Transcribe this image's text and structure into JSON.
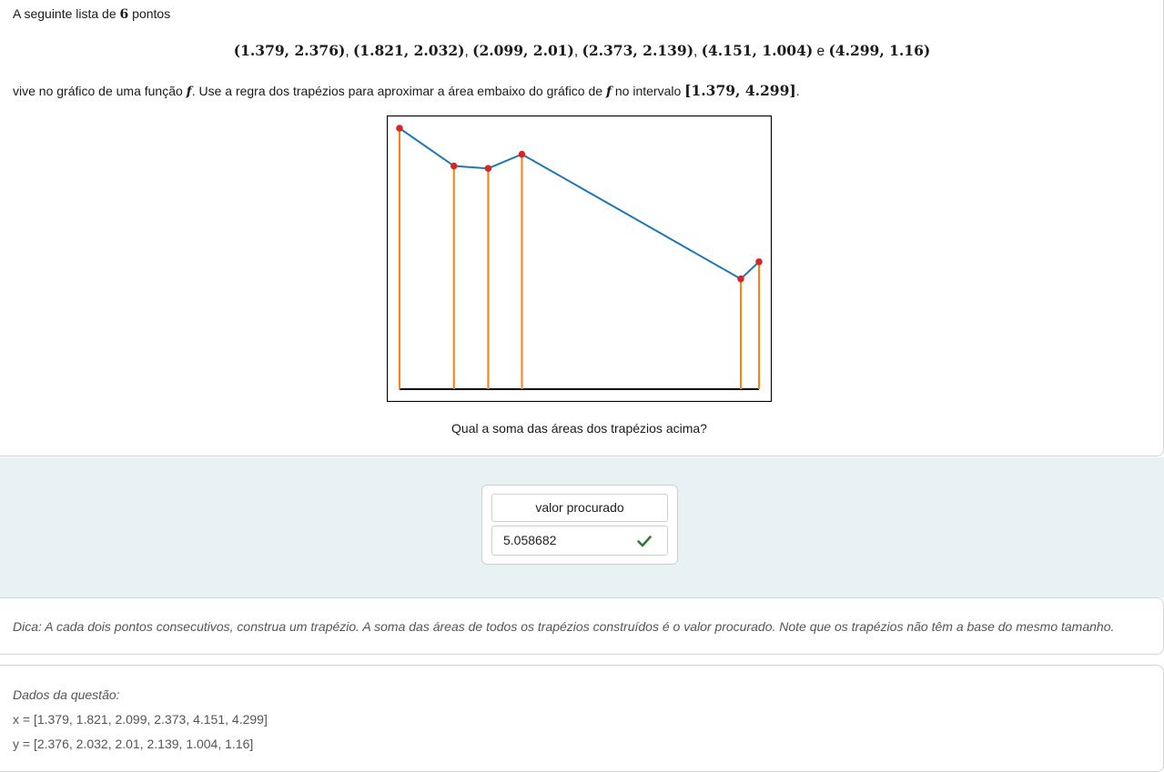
{
  "question": {
    "intro_text": "A seguinte lista de",
    "count": "6",
    "intro_suffix": "pontos",
    "points_text": [
      "(1.379, 2.376)",
      "(1.821, 2.032)",
      "(2.099, 2.01)",
      "(2.373, 2.139)",
      "(4.151, 1.004)",
      "(4.299, 1.16)"
    ],
    "points_sep": ",",
    "points_and": "e",
    "task_prefix": "vive no gráfico de uma função",
    "function_symbol": "f",
    "task_middle": ". Use a regra dos trapézios para aproximar a área embaixo do gráfico de",
    "task_middle2": "no intervalo",
    "interval": "[1.379, 4.299]",
    "task_end": ".",
    "ask": "Qual a soma das áreas dos trapézios acima?"
  },
  "chart_data": {
    "type": "line",
    "x": [
      1.379,
      1.821,
      2.099,
      2.373,
      4.151,
      4.299
    ],
    "series": [
      {
        "values": [
          2.376,
          2.032,
          2.01,
          2.139,
          1.004,
          1.16
        ]
      }
    ],
    "title": "",
    "xlabel": "",
    "ylabel": "",
    "xlim": [
      1.379,
      4.299
    ],
    "ylim": [
      0,
      2.376
    ],
    "grid": false,
    "colors": {
      "line": "#1f77b4",
      "points": "#d62728",
      "verticals": "#ff7f0e",
      "baseline": "#000000"
    }
  },
  "answer": {
    "label": "valor procurado",
    "value": "5.058682",
    "status_icon": "check-icon",
    "status_color": "#2e7d32"
  },
  "hint": {
    "text": "Dica: A cada dois pontos consecutivos, construa um trapézio. A soma das áreas de todos os trapézios construídos é o valor procurado. Note que os trapézios não têm a base do mesmo tamanho."
  },
  "data_section": {
    "title": "Dados da questão:",
    "x_line": "x = [1.379, 1.821, 2.099, 2.373, 4.151, 4.299]",
    "y_line": "y = [2.376, 2.032, 2.01, 2.139, 1.004, 1.16]"
  },
  "colors": {
    "answer_band": "#e8f1f3",
    "card_border": "#d4d4d4"
  }
}
